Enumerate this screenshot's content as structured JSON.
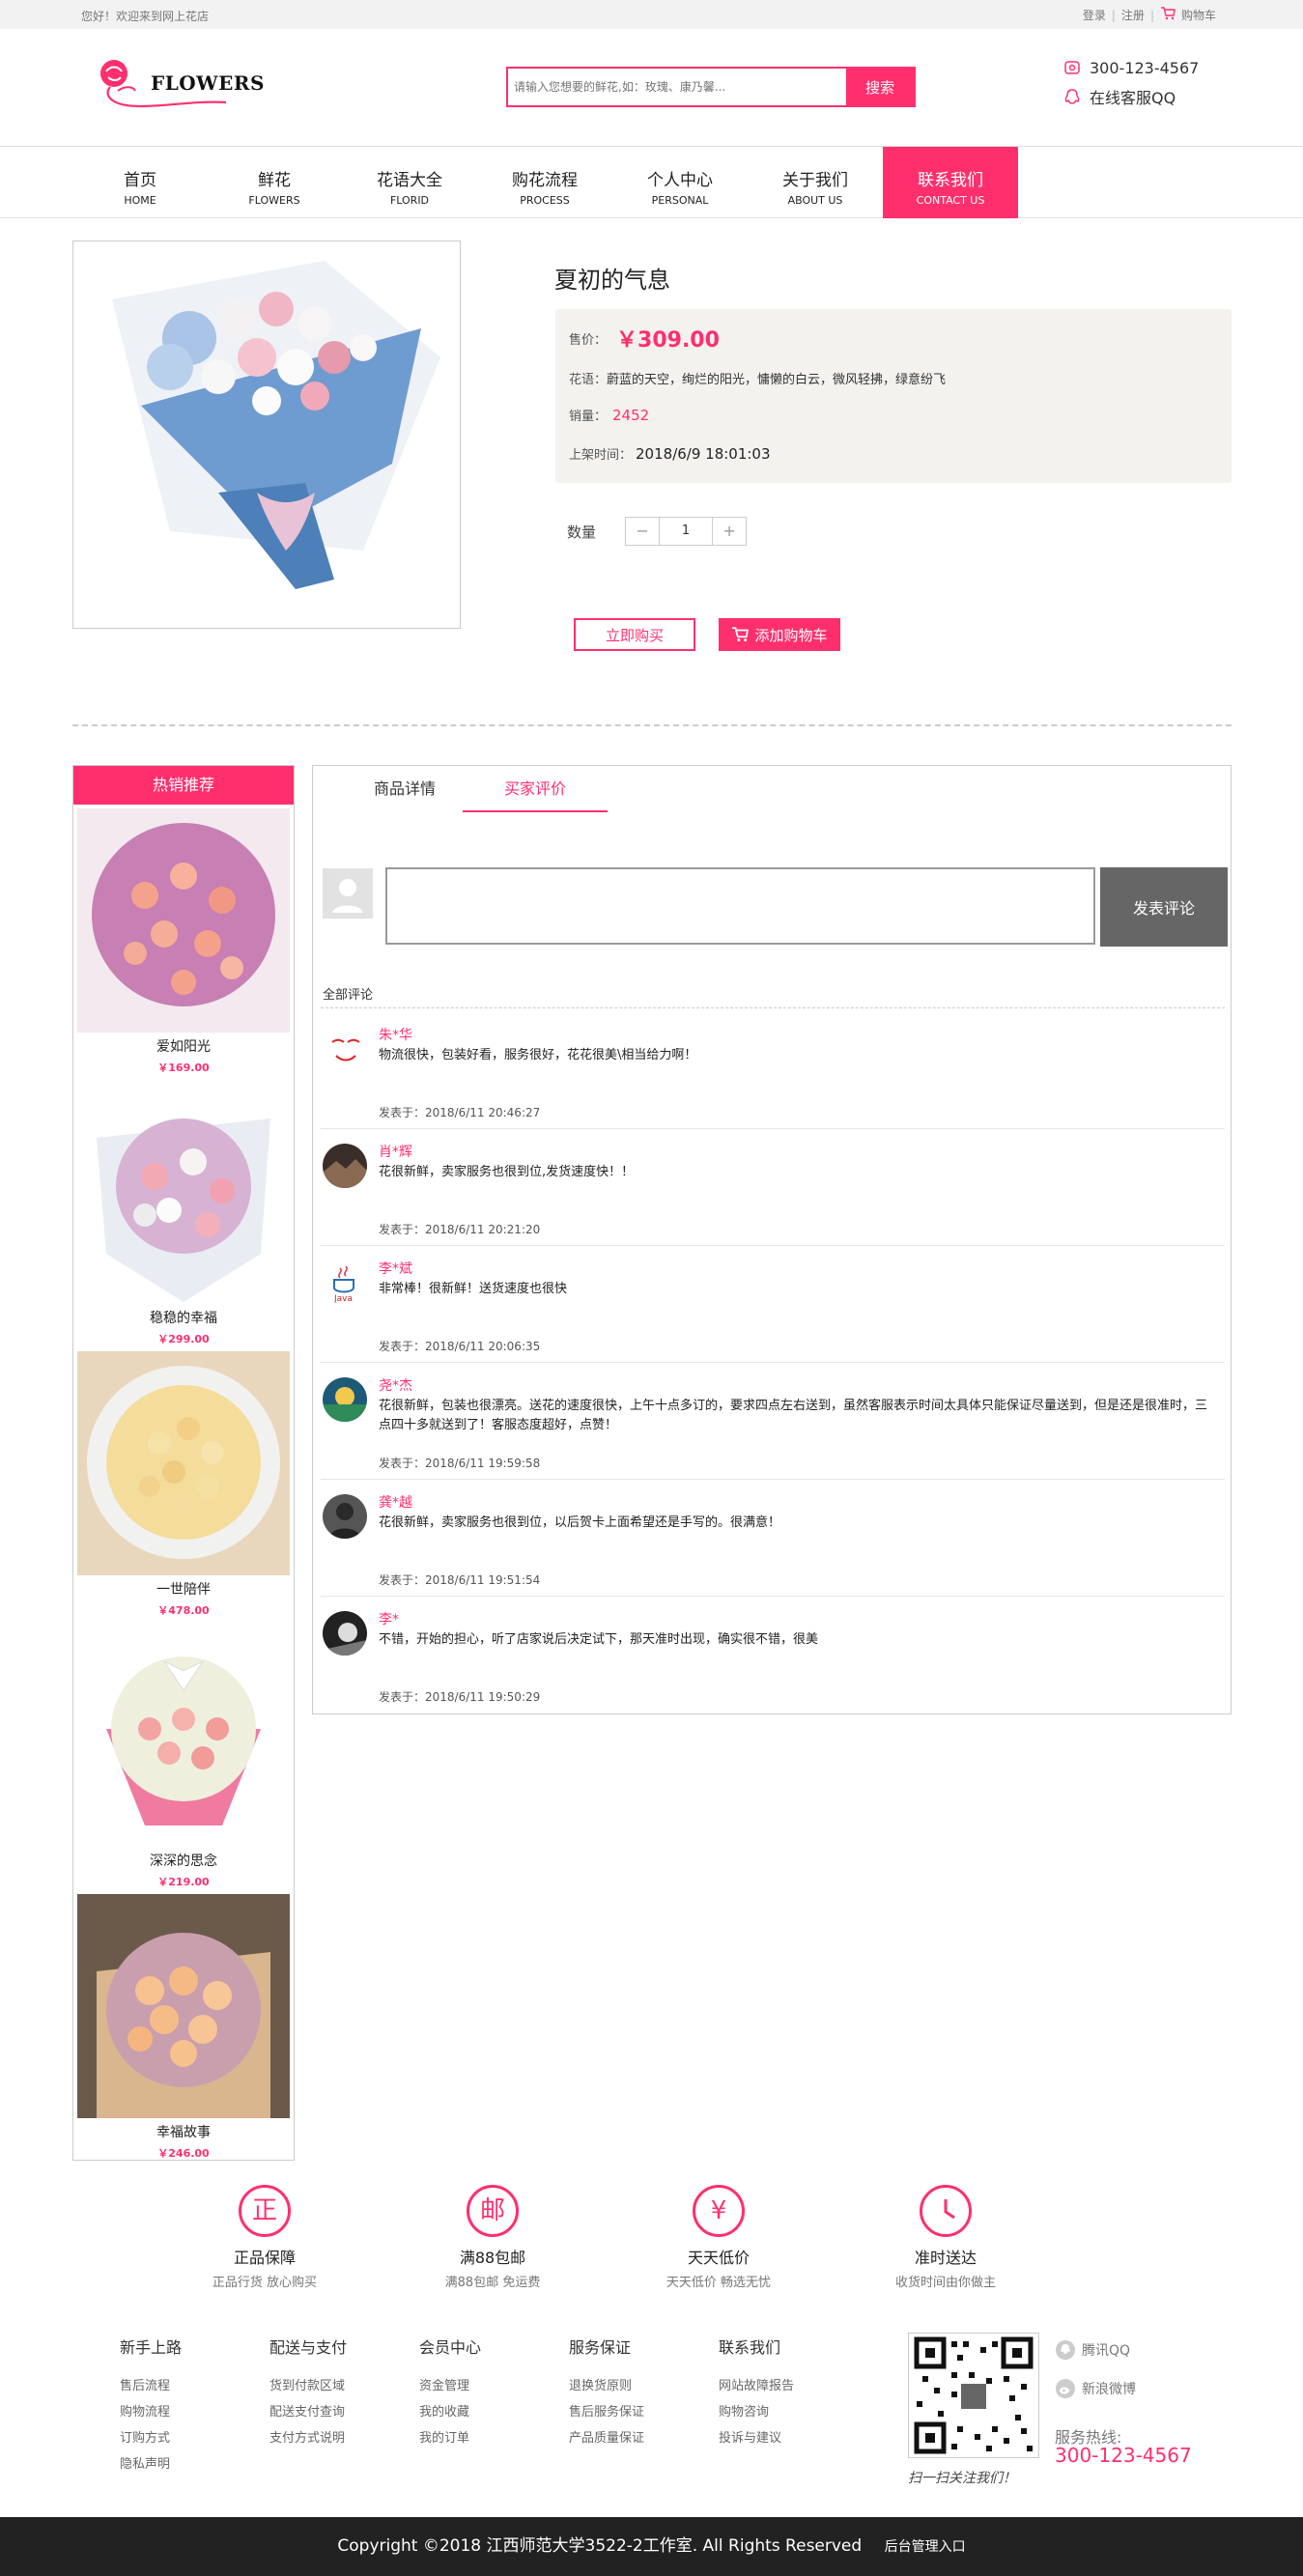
{
  "topbar": {
    "welcome": "您好！欢迎来到网上花店",
    "login": "登录",
    "register": "注册",
    "cart": "购物车"
  },
  "header": {
    "logo_text": "FLOWERS",
    "search_placeholder": "请输入您想要的鲜花,如：玫瑰、康乃馨...",
    "search_button": "搜索",
    "phone": "300-123-4567",
    "qq": "在线客服QQ"
  },
  "nav": [
    {
      "cn": "首页",
      "en": "HOME"
    },
    {
      "cn": "鲜花",
      "en": "FLOWERS"
    },
    {
      "cn": "花语大全",
      "en": "FLORID"
    },
    {
      "cn": "购花流程",
      "en": "PROCESS"
    },
    {
      "cn": "个人中心",
      "en": "PERSONAL"
    },
    {
      "cn": "关于我们",
      "en": "ABOUT US"
    },
    {
      "cn": "联系我们",
      "en": "CONTACT US"
    }
  ],
  "product": {
    "title": "夏初的气息",
    "price_label": "售价：",
    "price": "￥309.00",
    "meaning_label": "花语：",
    "meaning": "蔚蓝的天空，绚烂的阳光，慵懒的白云，微风轻拂，绿意纷飞",
    "sales_label": "销量：",
    "sales": "2452",
    "date_label": "上架时间：",
    "date": "2018/6/9 18:01:03",
    "qty_label": "数量",
    "qty_minus": "−",
    "qty_value": "1",
    "qty_plus": "+",
    "buy_now": "立即购买",
    "add_cart": "添加购物车"
  },
  "sidebar": {
    "title": "热销推荐",
    "items": [
      {
        "name": "爱如阳光",
        "price": "￥169.00"
      },
      {
        "name": "稳稳的幸福",
        "price": "￥299.00"
      },
      {
        "name": "一世陪伴",
        "price": "￥478.00"
      },
      {
        "name": "深深的思念",
        "price": "￥219.00"
      },
      {
        "name": "幸福故事",
        "price": "￥246.00"
      }
    ]
  },
  "review": {
    "tabs": [
      "商品详情",
      "买家评价"
    ],
    "submit": "发表评论",
    "all_title": "全部评论",
    "time_prefix": "发表于：",
    "comments": [
      {
        "user": "朱*华",
        "text": "物流很快，包装好看，服务很好，花花很美\\相当给力啊！",
        "time": "2018/6/11 20:46:27"
      },
      {
        "user": "肖*辉",
        "text": "花很新鲜，卖家服务也很到位,发货速度快！！",
        "time": "2018/6/11 20:21:20"
      },
      {
        "user": "李*斌",
        "text": "非常棒！很新鲜！送货速度也很快",
        "time": "2018/6/11 20:06:35"
      },
      {
        "user": "尧*杰",
        "text": "花很新鲜，包装也很漂亮。送花的速度很快，上午十点多订的，要求四点左右送到，虽然客服表示时间太具体只能保证尽量送到，但是还是很准时，三点四十多就送到了！客服态度超好，点赞！",
        "time": "2018/6/11 19:59:58"
      },
      {
        "user": "龚*越",
        "text": "花很新鲜，卖家服务也很到位，以后贺卡上面希望还是手写的。很满意！",
        "time": "2018/6/11 19:51:54"
      },
      {
        "user": "李*",
        "text": "不错，开始的担心，听了店家说后决定试下，那天准时出现，确实很不错，很美",
        "time": "2018/6/11 19:50:29"
      }
    ]
  },
  "guarantees": [
    {
      "icon": "正",
      "title": "正品保障",
      "sub": "正品行货 放心购买"
    },
    {
      "icon": "邮",
      "title": "满88包邮",
      "sub": "满88包邮 免运费"
    },
    {
      "icon": "¥",
      "title": "天天低价",
      "sub": "天天低价 畅选无忧"
    },
    {
      "icon": "",
      "title": "准时送达",
      "sub": "收货时间由你做主"
    }
  ],
  "footer_cols": [
    {
      "title": "新手上路",
      "links": [
        "售后流程",
        "购物流程",
        "订购方式",
        "隐私声明"
      ]
    },
    {
      "title": "配送与支付",
      "links": [
        "货到付款区域",
        "配送支付查询",
        "支付方式说明"
      ]
    },
    {
      "title": "会员中心",
      "links": [
        "资金管理",
        "我的收藏",
        "我的订单"
      ]
    },
    {
      "title": "服务保证",
      "links": [
        "退换货原则",
        "售后服务保证",
        "产品质量保证"
      ]
    },
    {
      "title": "联系我们",
      "links": [
        "网站故障报告",
        "购物咨询",
        "投诉与建议"
      ]
    }
  ],
  "footer_side": {
    "qr_caption": "扫一扫关注我们！",
    "qq": "腾讯QQ",
    "weibo": "新浪微博",
    "hotline_label": "服务热线:",
    "hotline": "300-123-4567"
  },
  "copyright": "Copyright ©2018  江西师范大学3522-2工作室. All Rights Reserved",
  "admin_link": "后台管理入口",
  "colors": {
    "accent": "#ff2f6d"
  }
}
